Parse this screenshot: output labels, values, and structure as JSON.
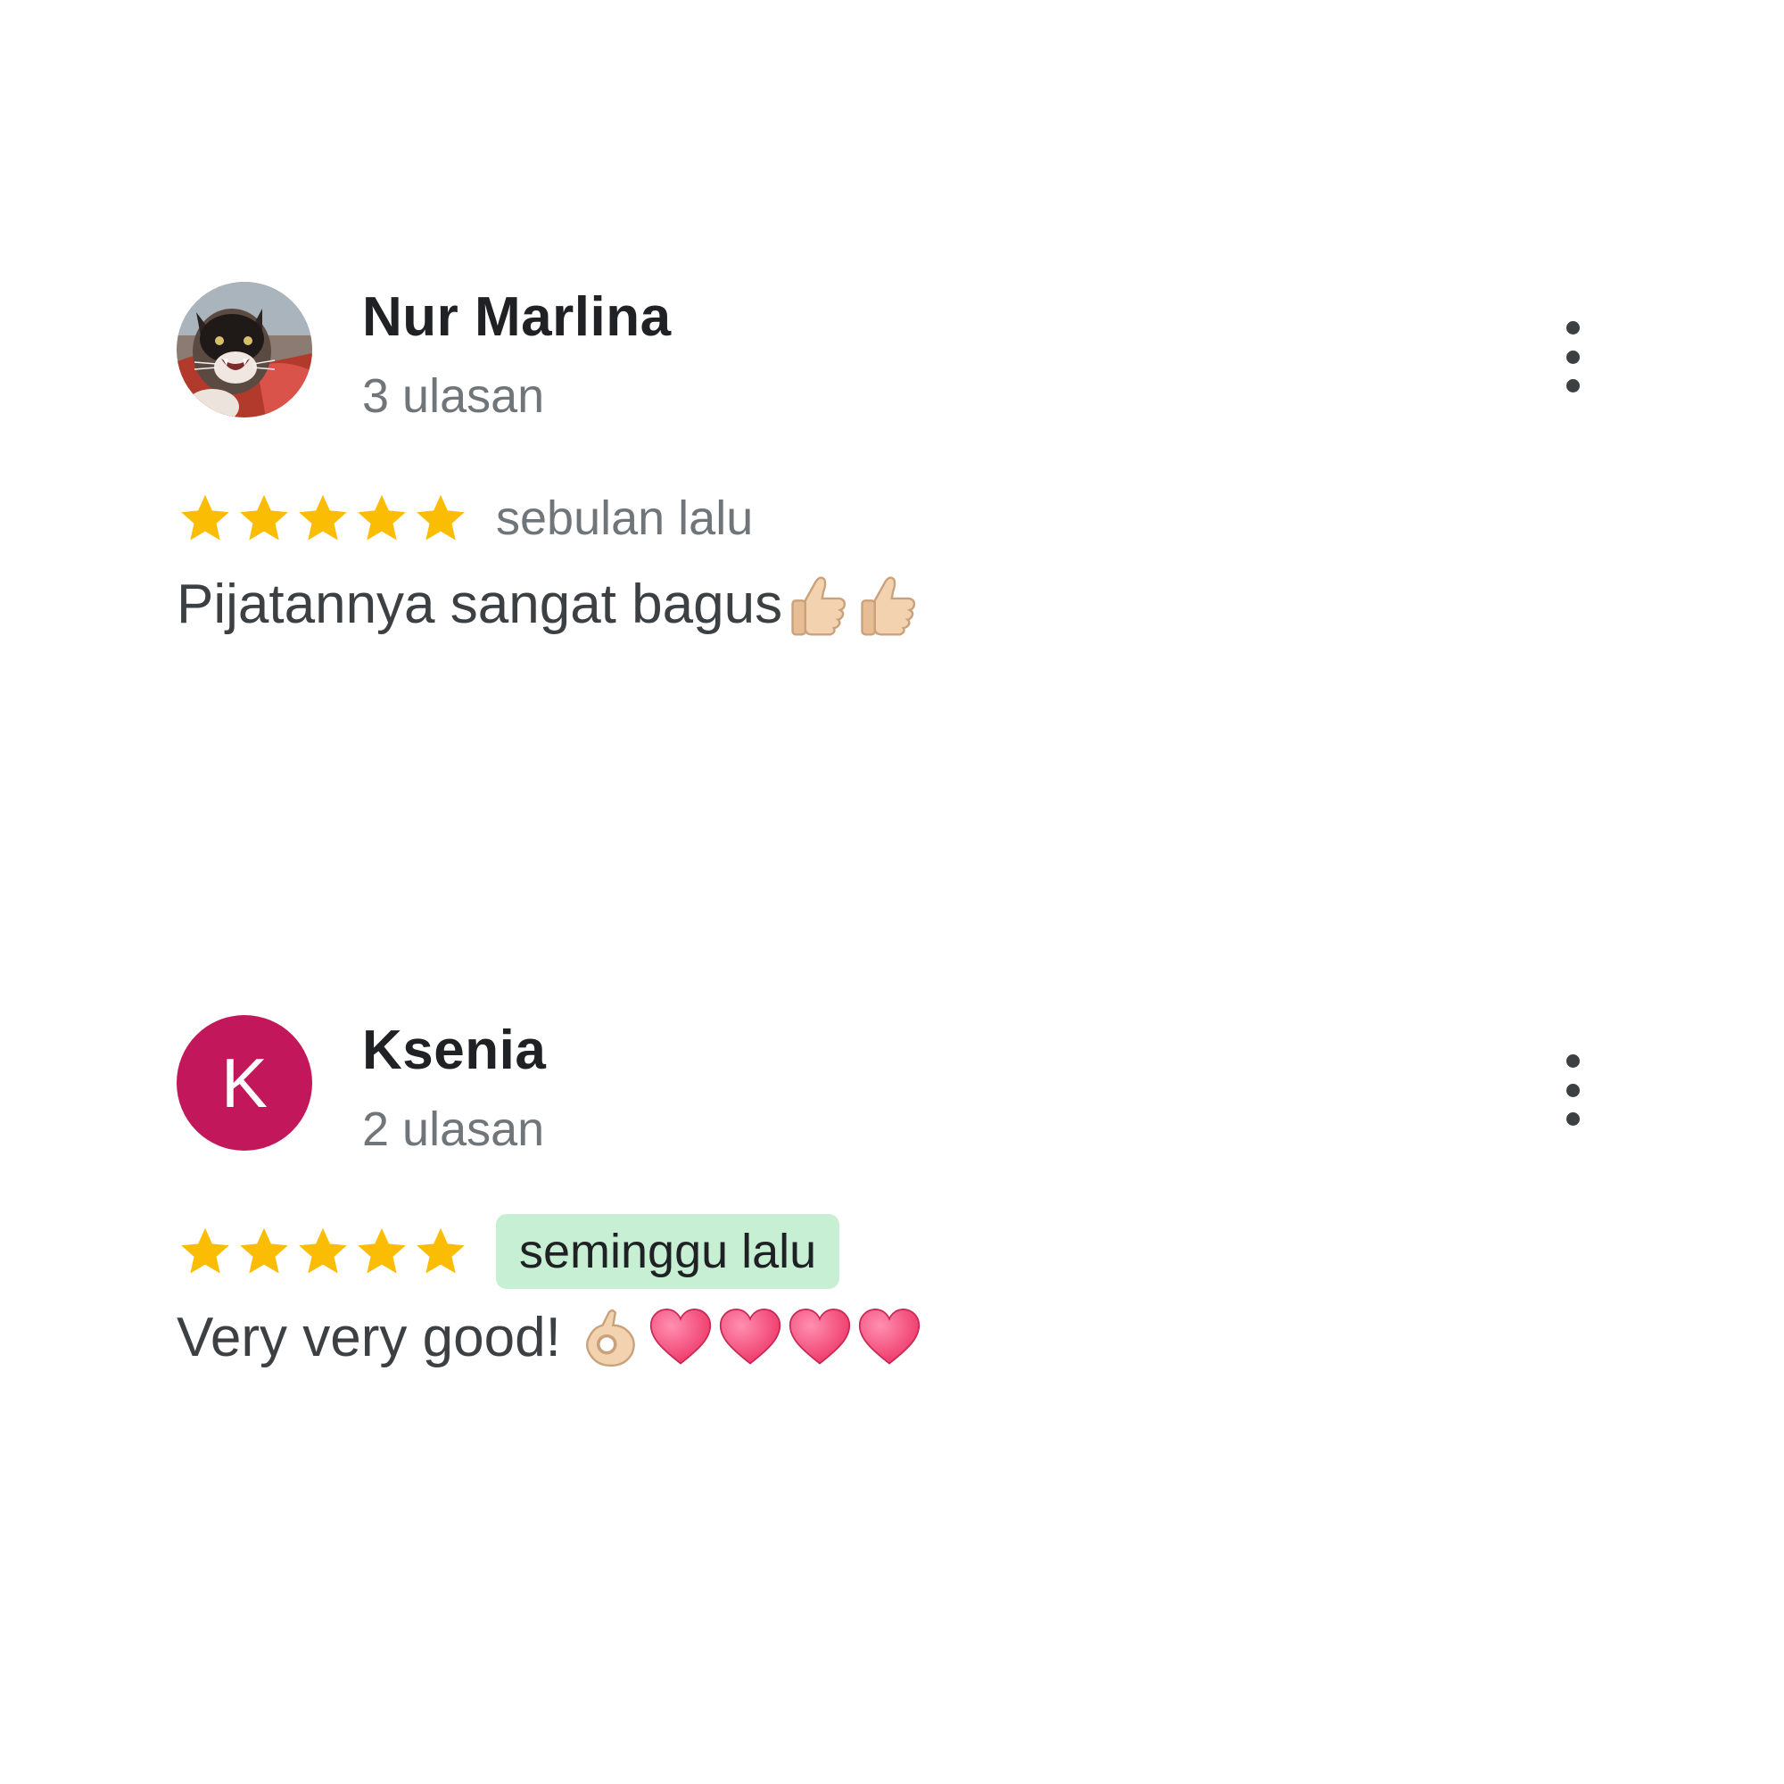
{
  "reviews": [
    {
      "author": "Nur Marlina",
      "review_count": "3 ulasan",
      "avatar": {
        "type": "photo",
        "icon": "cat-photo-avatar"
      },
      "rating": 5,
      "rating_max": 5,
      "time": "sebulan lalu",
      "time_highlighted": false,
      "text": "Pijatannya sangat bagus",
      "emojis": [
        "thumbs-up-icon",
        "thumbs-up-icon"
      ]
    },
    {
      "author": "Ksenia",
      "review_count": "2 ulasan",
      "avatar": {
        "type": "letter",
        "letter": "K",
        "color": "#c2185b"
      },
      "rating": 5,
      "rating_max": 5,
      "time": "seminggu lalu",
      "time_highlighted": true,
      "text": "Very very good!",
      "emojis": [
        "ok-hand-icon",
        "heart-icon",
        "heart-icon",
        "heart-icon",
        "heart-icon"
      ]
    }
  ],
  "colors": {
    "star": "#fbbc04",
    "text_primary": "#202124",
    "text_secondary": "#70757a",
    "highlight_bg": "#c6efd3",
    "heart": "#ef3b6b"
  }
}
